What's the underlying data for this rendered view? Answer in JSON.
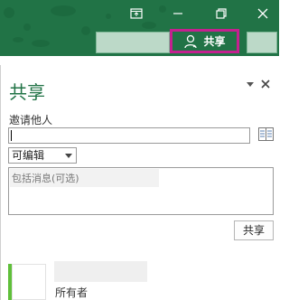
{
  "window": {
    "ribbon_display_icon": "ribbon-display-icon",
    "minimize_icon": "minimize-icon",
    "restore_icon": "restore-icon",
    "close_icon": "close-icon"
  },
  "ribbon": {
    "share_button_label": "共享",
    "share_button_icon": "person-icon"
  },
  "share_pane": {
    "title": "共享",
    "options_icon": "chevron-down-icon",
    "close_icon": "close-icon",
    "invite_label": "邀请他人",
    "invite_value": "",
    "address_book_icon": "address-book-icon",
    "permission_selected": "可编辑",
    "message_placeholder": "包括消息(可选)",
    "share_submit_label": "共享",
    "owner_role": "所有者"
  },
  "colors": {
    "ribbon_green": "#217346",
    "highlight_magenta": "#c4208f",
    "owner_presence_green": "#5fbf3a"
  }
}
